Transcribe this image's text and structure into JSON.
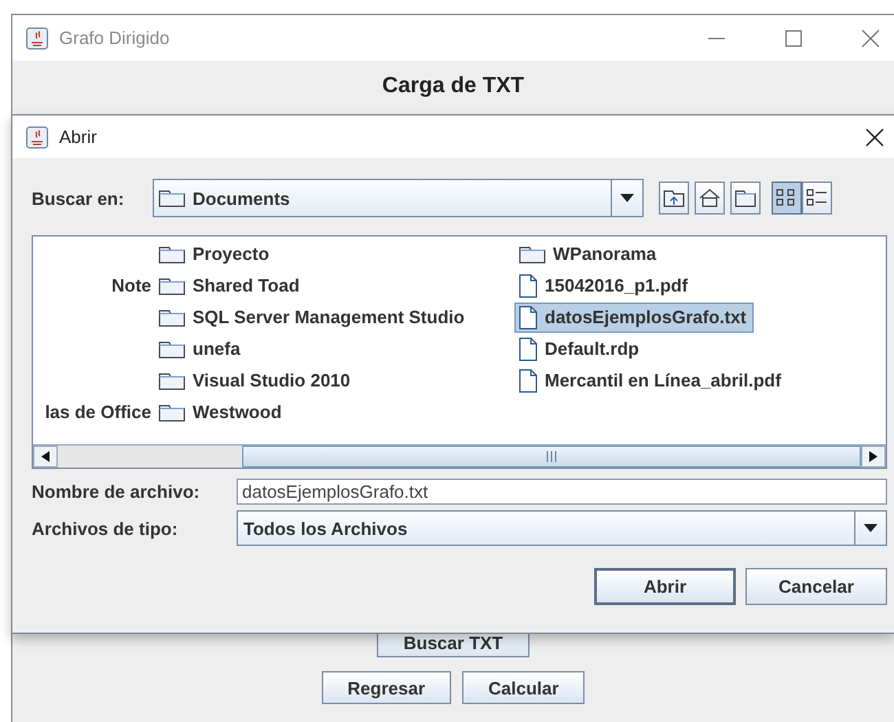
{
  "window": {
    "title": "Grafo Dirigido"
  },
  "heading": "Carga de TXT",
  "dialog": {
    "title": "Abrir",
    "look_in": {
      "label": "Buscar en:",
      "value": "Documents"
    },
    "toolbar": [
      {
        "kind": "up",
        "selected": false
      },
      {
        "kind": "home",
        "selected": false
      },
      {
        "kind": "new-folder",
        "selected": false
      },
      {
        "kind": "list",
        "selected": true
      },
      {
        "kind": "details",
        "selected": false
      }
    ],
    "files": [
      {
        "entries": [
          {
            "name": "Proyecto",
            "kind": "folder",
            "selected": false
          },
          {
            "name": "WPanorama",
            "kind": "folder",
            "selected": false
          }
        ]
      },
      {
        "cut_name": "Note",
        "entries": [
          {
            "name": "Shared Toad",
            "kind": "folder",
            "selected": false
          },
          {
            "name": "15042016_p1.pdf",
            "kind": "file",
            "selected": false
          }
        ]
      },
      {
        "entries": [
          {
            "name": "SQL Server Management Studio",
            "kind": "folder",
            "selected": false
          },
          {
            "name": "datosEjemplosGrafo.txt",
            "kind": "file",
            "selected": true
          }
        ]
      },
      {
        "entries": [
          {
            "name": "unefa",
            "kind": "folder",
            "selected": false
          },
          {
            "name": "Default.rdp",
            "kind": "file",
            "selected": false
          }
        ]
      },
      {
        "entries": [
          {
            "name": "Visual Studio 2010",
            "kind": "folder",
            "selected": false
          },
          {
            "name": "Mercantil en Línea_abril.pdf",
            "kind": "file",
            "selected": false
          }
        ]
      },
      {
        "cut_name": "las de Office",
        "entries": [
          {
            "name": "Westwood",
            "kind": "folder",
            "selected": false
          }
        ]
      }
    ],
    "file_name": {
      "label": "Nombre de archivo:",
      "value": "datosEjemplosGrafo.txt"
    },
    "file_type": {
      "label": "Archivos de tipo:",
      "value": "Todos los Archivos"
    },
    "buttons": [
      {
        "label": "Abrir",
        "default": true
      },
      {
        "label": "Cancelar",
        "default": false
      }
    ]
  },
  "buttons": [
    "Buscar TXT"
  ],
  "bottom_buttons": [
    "Regresar",
    "Calcular"
  ]
}
